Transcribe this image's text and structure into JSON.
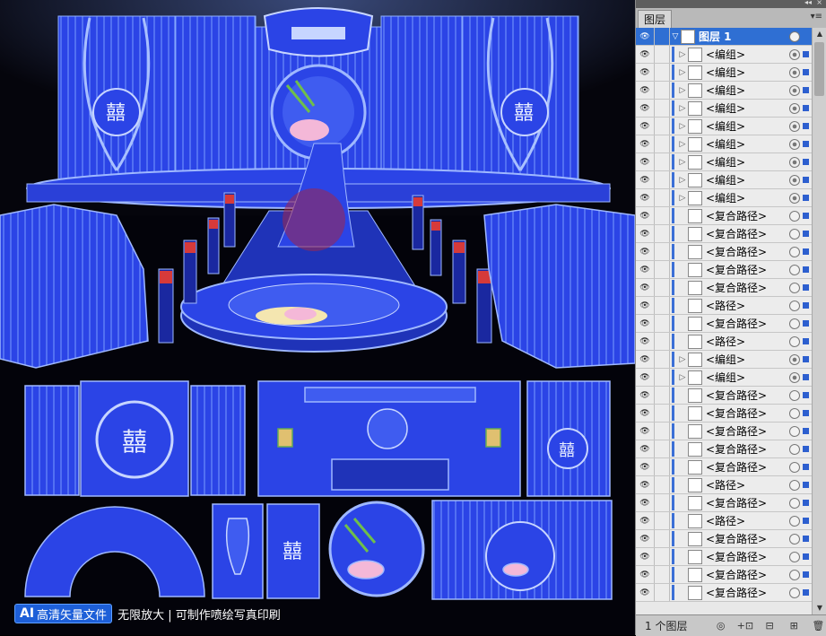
{
  "watermark": {
    "badge_ai": "AI",
    "badge_text": "高清矢量文件",
    "tagline": "无限放大 | 可制作喷绘写真印刷"
  },
  "panel": {
    "tab": "图层",
    "menu_icon": "▾≡",
    "collapse_icon": "◂◂",
    "close_icon": "×",
    "layer_count": "1 个图层",
    "top_layer": {
      "name": "图层 1"
    },
    "layers": [
      {
        "name": "<编组>",
        "expand": true
      },
      {
        "name": "<编组>",
        "expand": true
      },
      {
        "name": "<编组>",
        "expand": true
      },
      {
        "name": "<编组>",
        "expand": true
      },
      {
        "name": "<编组>",
        "expand": true
      },
      {
        "name": "<编组>",
        "expand": true
      },
      {
        "name": "<编组>",
        "expand": true
      },
      {
        "name": "<编组>",
        "expand": true
      },
      {
        "name": "<编组>",
        "expand": true
      },
      {
        "name": "<复合路径>",
        "expand": false
      },
      {
        "name": "<复合路径>",
        "expand": false
      },
      {
        "name": "<复合路径>",
        "expand": false
      },
      {
        "name": "<复合路径>",
        "expand": false
      },
      {
        "name": "<复合路径>",
        "expand": false
      },
      {
        "name": "<路径>",
        "expand": false
      },
      {
        "name": "<复合路径>",
        "expand": false
      },
      {
        "name": "<路径>",
        "expand": false
      },
      {
        "name": "<编组>",
        "expand": true
      },
      {
        "name": "<编组>",
        "expand": true
      },
      {
        "name": "<复合路径>",
        "expand": false
      },
      {
        "name": "<复合路径>",
        "expand": false
      },
      {
        "name": "<复合路径>",
        "expand": false
      },
      {
        "name": "<复合路径>",
        "expand": false
      },
      {
        "name": "<复合路径>",
        "expand": false
      },
      {
        "name": "<路径>",
        "expand": false
      },
      {
        "name": "<复合路径>",
        "expand": false
      },
      {
        "name": "<路径>",
        "expand": false
      },
      {
        "name": "<复合路径>",
        "expand": false
      },
      {
        "name": "<复合路径>",
        "expand": false
      },
      {
        "name": "<复合路径>",
        "expand": false
      },
      {
        "name": "<复合路径>",
        "expand": false
      }
    ],
    "footer_buttons": [
      "◎",
      "+⊡",
      "⊟",
      "⊞",
      "🗑"
    ]
  },
  "colors": {
    "artwork_blue": "#2b44e6",
    "outline_blue": "#7a9cff",
    "selection_blue": "#2f6fd3",
    "panel_gray": "#d6d6d6"
  }
}
